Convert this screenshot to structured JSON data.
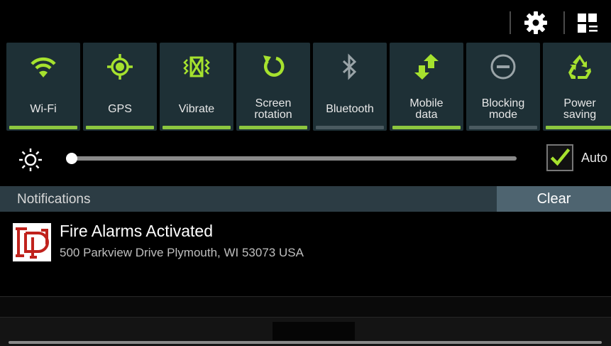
{
  "quick_settings": {
    "tiles": [
      {
        "label": "Wi-Fi",
        "icon": "wifi-icon",
        "on": true
      },
      {
        "label": "GPS",
        "icon": "gps-icon",
        "on": true
      },
      {
        "label": "Vibrate",
        "icon": "vibrate-icon",
        "on": true
      },
      {
        "label": "Screen\nrotation",
        "icon": "screen-rotation-icon",
        "on": true
      },
      {
        "label": "Bluetooth",
        "icon": "bluetooth-icon",
        "on": false
      },
      {
        "label": "Mobile\ndata",
        "icon": "mobile-data-icon",
        "on": true
      },
      {
        "label": "Blocking\nmode",
        "icon": "blocking-mode-icon",
        "on": false
      },
      {
        "label": "Power\nsaving",
        "icon": "power-saving-icon",
        "on": true
      }
    ],
    "colors": {
      "on": "#8dc63f",
      "off": "#4a5a60",
      "icon_on": "#a6e22e",
      "icon_off": "#9aa4a8"
    }
  },
  "brightness": {
    "level": 0.0,
    "auto_label": "Auto",
    "auto_checked": true
  },
  "notifications": {
    "header_label": "Notifications",
    "clear_label": "Clear",
    "items": [
      {
        "title": "Fire Alarms Activated",
        "subtitle": "500 Parkview Drive Plymouth, WI 53073 USA",
        "icon": "fire-department-logo"
      }
    ]
  }
}
